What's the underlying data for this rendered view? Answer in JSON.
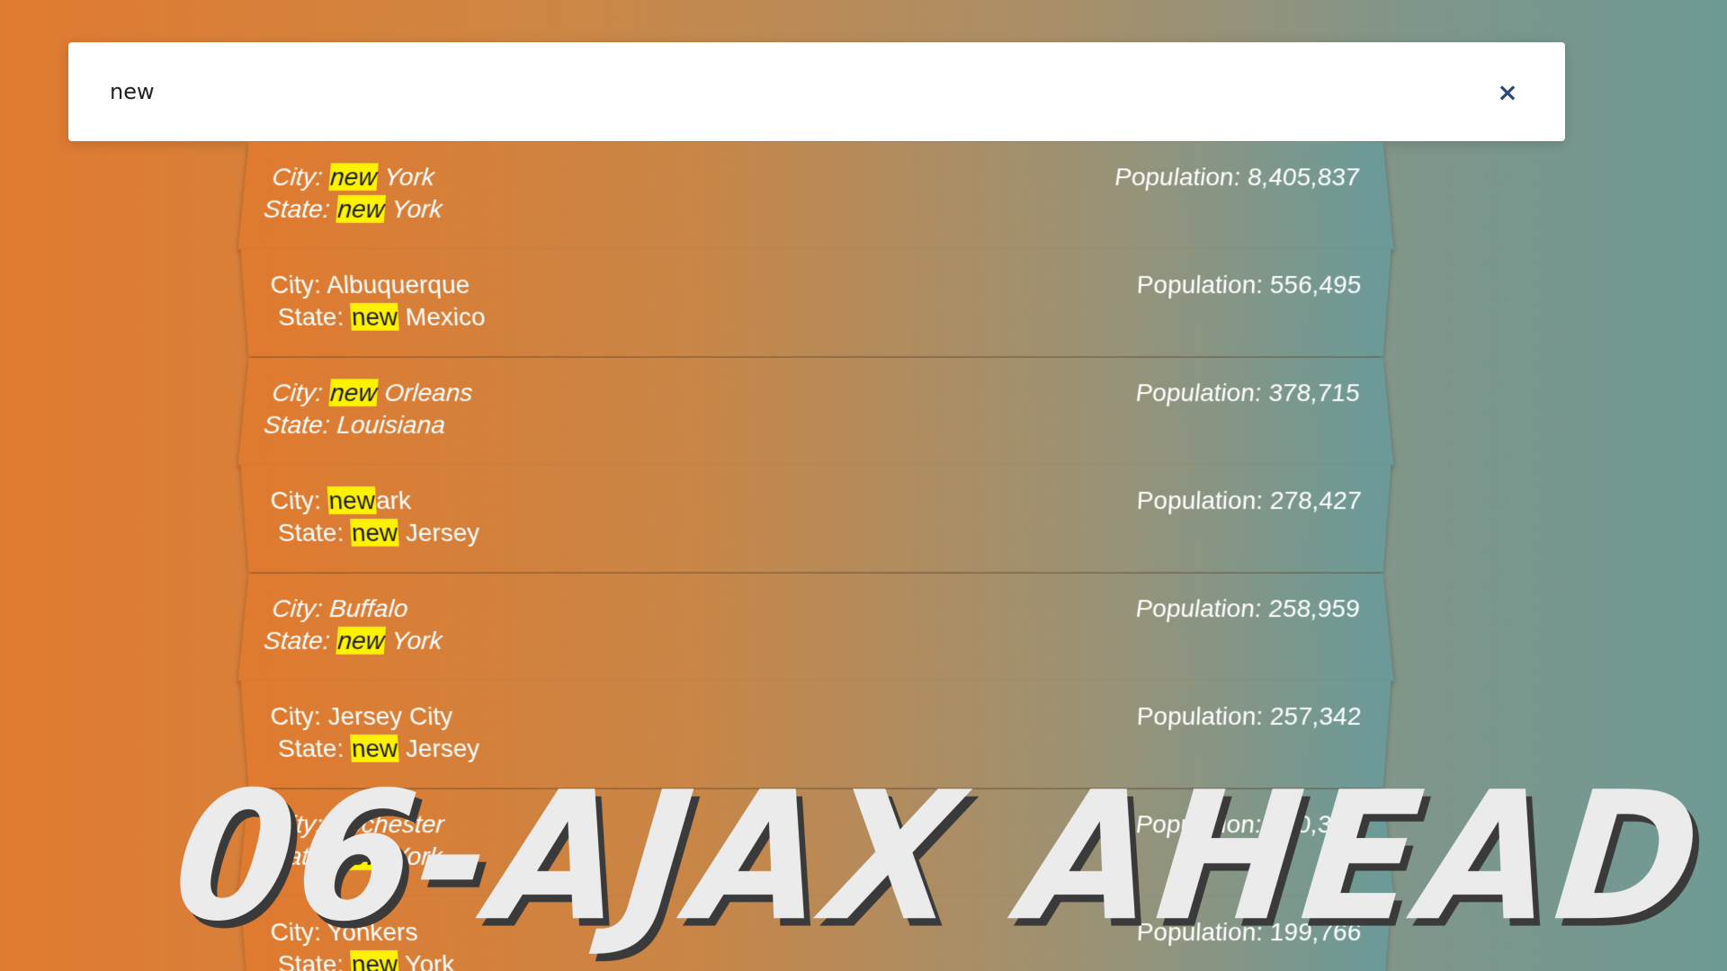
{
  "search": {
    "value": "new",
    "clear_icon": "×"
  },
  "highlight_color": "#fff200",
  "results": [
    {
      "city_prefix": "City: ",
      "city_parts": [
        "",
        "new",
        " York"
      ],
      "state_prefix": "State: ",
      "state_parts": [
        "",
        "new",
        " York"
      ],
      "population": "Population: 8,405,837"
    },
    {
      "city_prefix": "City: ",
      "city_parts": [
        "Albuquerque",
        "",
        ""
      ],
      "state_prefix": "State: ",
      "state_parts": [
        "",
        "new",
        " Mexico"
      ],
      "population": "Population: 556,495"
    },
    {
      "city_prefix": "City: ",
      "city_parts": [
        "",
        "new",
        " Orleans"
      ],
      "state_prefix": "State: ",
      "state_parts": [
        "Louisiana",
        "",
        ""
      ],
      "population": "Population: 378,715"
    },
    {
      "city_prefix": "City: ",
      "city_parts": [
        "",
        "new",
        "ark"
      ],
      "state_prefix": "State: ",
      "state_parts": [
        "",
        "new",
        " Jersey"
      ],
      "population": "Population: 278,427"
    },
    {
      "city_prefix": "City: ",
      "city_parts": [
        "Buffalo",
        "",
        ""
      ],
      "state_prefix": "State: ",
      "state_parts": [
        "",
        "new",
        " York"
      ],
      "population": "Population: 258,959"
    },
    {
      "city_prefix": "City: ",
      "city_parts": [
        "Jersey City",
        "",
        ""
      ],
      "state_prefix": "State: ",
      "state_parts": [
        "",
        "new",
        " Jersey"
      ],
      "population": "Population: 257,342"
    },
    {
      "city_prefix": "City: ",
      "city_parts": [
        "Rochester",
        "",
        ""
      ],
      "state_prefix": "State: ",
      "state_parts": [
        "",
        "new",
        " York"
      ],
      "population": "Population: 210,358"
    },
    {
      "city_prefix": "City: ",
      "city_parts": [
        "Yonkers",
        "",
        ""
      ],
      "state_prefix": "State: ",
      "state_parts": [
        "",
        "new",
        " York"
      ],
      "population": "Population: 199,766"
    }
  ],
  "overlay_title": "06-AJAX AHEAD"
}
